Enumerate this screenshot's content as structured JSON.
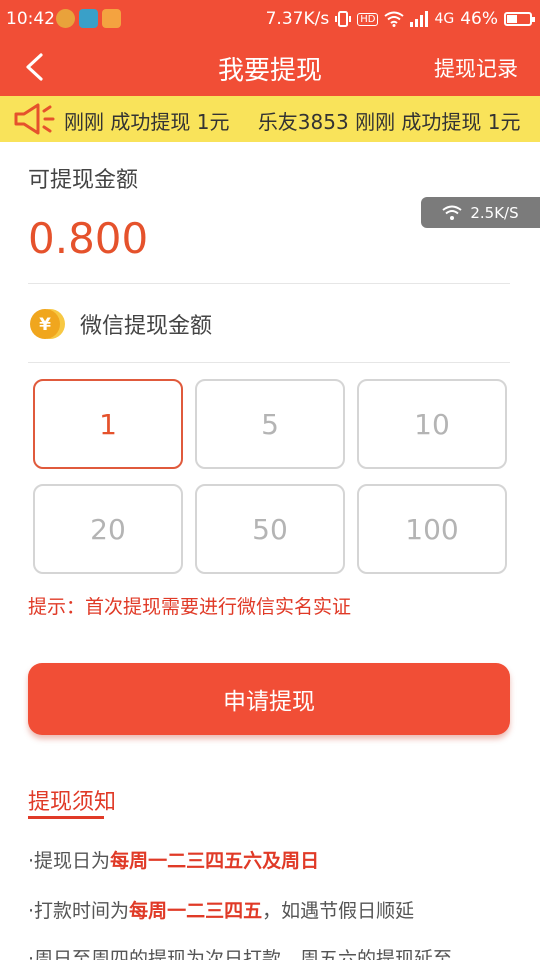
{
  "status_bar": {
    "time": "10:42",
    "net_speed": "7.37K/s",
    "hd_label": "HD",
    "network": "4G",
    "battery": "46%",
    "battery_level": 0.46
  },
  "nav": {
    "title": "我要提现",
    "record_label": "提现记录"
  },
  "ticker": {
    "items": [
      "刚刚 成功提现 1元",
      "乐友3853 刚刚 成功提现 1元"
    ]
  },
  "balance": {
    "label": "可提现金额",
    "amount": "0.800"
  },
  "speed_badge": "2.5K/S",
  "wechat": {
    "label": "微信提现金额",
    "coin_symbol": "¥"
  },
  "options": {
    "selected_index": 0,
    "values": [
      "1",
      "5",
      "10",
      "20",
      "50",
      "100"
    ]
  },
  "hint": "提示：首次提现需要进行微信实名实证",
  "apply_button": "申请提现",
  "notice": {
    "title": "提现须知",
    "items": [
      {
        "prefix": "提现日为",
        "highlight": "每周一二三四五六及周日",
        "suffix": ""
      },
      {
        "prefix": "打款时间为",
        "highlight": "每周一二三四五",
        "suffix": "，如遇节假日顺延"
      },
      {
        "prefix": "周日至周四的提现为次日打款，周五六的提现延至",
        "highlight": "",
        "suffix": ""
      }
    ]
  },
  "colors": {
    "brand": "#f14e36",
    "ticker_bg": "#f9e35a",
    "highlight": "#e03a27"
  }
}
